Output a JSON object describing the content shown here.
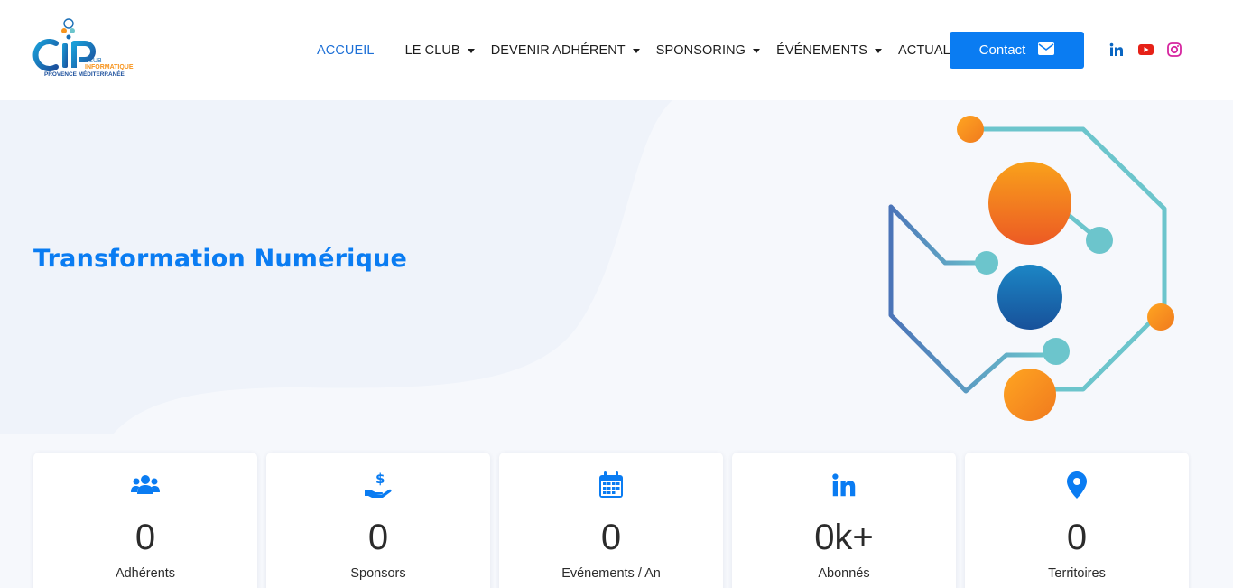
{
  "logo": {
    "letters": "CIP",
    "line1": "CLUB",
    "line2": "INFORMATIQUE",
    "line3": "PROVENCE MÉDITERRANÉE"
  },
  "nav": {
    "items": [
      {
        "label": "ACCUEIL",
        "active": true,
        "dropdown": false
      },
      {
        "label": "LE CLUB",
        "active": false,
        "dropdown": true
      },
      {
        "label": "DEVENIR ADHÉRENT",
        "active": false,
        "dropdown": true
      },
      {
        "label": "SPONSORING",
        "active": false,
        "dropdown": true
      },
      {
        "label": "ÉVÉNEMENTS",
        "active": false,
        "dropdown": true
      },
      {
        "label": "ACTUALITÉ",
        "active": false,
        "dropdown": true
      }
    ],
    "contact_label": "Contact",
    "contact_icon": "envelope-icon",
    "social": [
      {
        "name": "linkedin-icon",
        "color": "#0a66c2"
      },
      {
        "name": "youtube-icon",
        "color": "#e62117"
      },
      {
        "name": "instagram-icon",
        "color": "#d6249f"
      }
    ]
  },
  "hero": {
    "title": "Transformation Numérique"
  },
  "colors": {
    "accent": "#0a7cf2",
    "hero_bg": "#f6f8fc",
    "teal": "#6cc5cc",
    "orange": "#f7941d"
  },
  "stats": [
    {
      "icon": "users-icon",
      "value": "0",
      "label": "Adhérents"
    },
    {
      "icon": "hand-dollar-icon",
      "value": "0",
      "label": "Sponsors"
    },
    {
      "icon": "calendar-icon",
      "value": "0",
      "label": "Evénements / An"
    },
    {
      "icon": "linkedin-icon",
      "value": "0k+",
      "label": "Abonnés"
    },
    {
      "icon": "map-marker-icon",
      "value": "0",
      "label": "Territoires"
    }
  ]
}
